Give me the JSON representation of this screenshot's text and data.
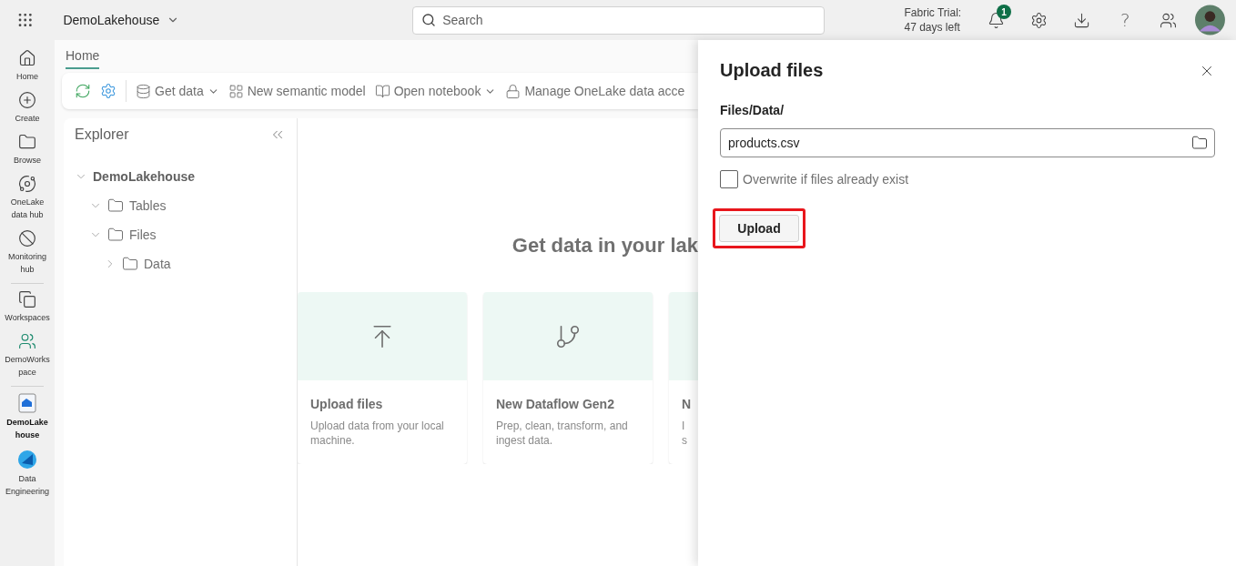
{
  "top_bar": {
    "workspace": "DemoLakehouse",
    "search": {
      "placeholder": "Search"
    },
    "trial": [
      "Fabric Trial:",
      "47 days left"
    ],
    "notifications": {
      "count": "1"
    },
    "help": "?"
  },
  "rail_groups": [
    {
      "items": [
        {
          "label": "Home",
          "selected": false
        },
        {
          "label": "Create",
          "selected": false
        },
        {
          "label": "Browse",
          "selected": false
        },
        {
          "label": "OneLake data hub",
          "selected": false
        },
        {
          "label": "Monitoring hub",
          "selected": false
        }
      ]
    },
    {
      "items": [
        {
          "label": "Workspaces",
          "selected": false
        },
        {
          "label": "DemoWorkspace",
          "selected": false
        }
      ]
    },
    {
      "items": [
        {
          "label": "DemoLakehouse",
          "selected": true
        },
        {
          "label": "Data Engineering",
          "selected": false
        }
      ]
    }
  ],
  "tabs": [
    {
      "label": "Home",
      "selected": true
    }
  ],
  "toolbar": [
    {
      "label": "Get data",
      "dropdown": true
    },
    {
      "label": "New semantic model",
      "dropdown": false
    },
    {
      "label": "Open notebook",
      "dropdown": true
    },
    {
      "label": "Manage OneLake data acce",
      "dropdown": false
    }
  ],
  "explorer": {
    "title": "Explorer",
    "tree": [
      {
        "label": "DemoLakehouse",
        "kind": "root",
        "expanded": true,
        "children": [
          {
            "label": "Tables",
            "kind": "folder",
            "expanded": true
          },
          {
            "label": "Files",
            "kind": "folder",
            "expanded": true,
            "children": [
              {
                "label": "Data",
                "kind": "folder",
                "expanded": false
              }
            ]
          }
        ]
      }
    ]
  },
  "canvas": {
    "heading": "Get data in your lak",
    "cards": [
      {
        "title": "Upload files",
        "lines": [
          "Upload data from your local",
          "machine."
        ]
      },
      {
        "title": "New Dataflow Gen2",
        "lines": [
          "Prep, clean, transform, and",
          "ingest data."
        ]
      },
      {
        "title": "N",
        "lines": [
          "I",
          "s"
        ]
      }
    ]
  },
  "panel": {
    "title": "Upload files",
    "path_label": "Files/Data/",
    "file_field": {
      "value": "products.csv"
    },
    "overwrite": {
      "label": "Overwrite if files already exist",
      "checked": false
    },
    "upload_button": {
      "label": "Upload",
      "highlighted": true
    }
  }
}
